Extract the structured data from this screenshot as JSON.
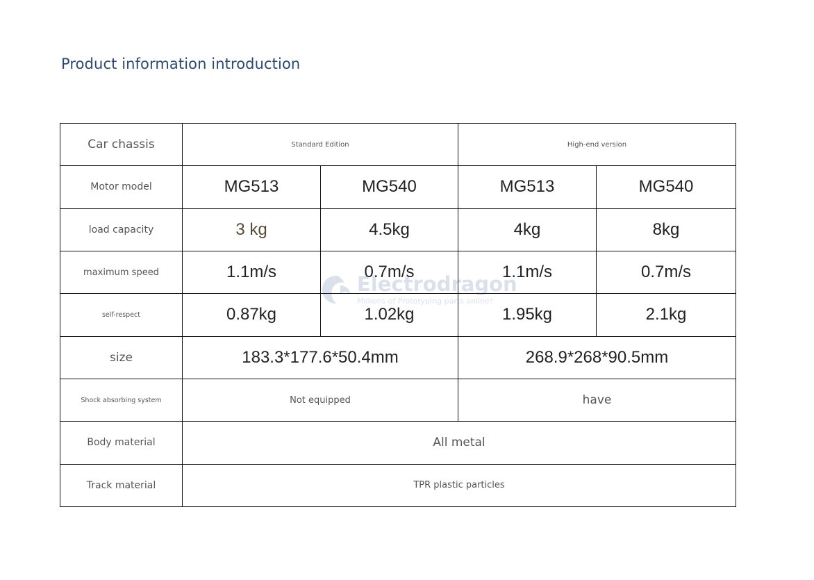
{
  "title": "Product information introduction",
  "watermark": {
    "name": "Electrodragon",
    "tagline": "Millions of Prototyping parts online!"
  },
  "table": {
    "car_chassis": {
      "label": "Car chassis",
      "standard": "Standard Edition",
      "high_end": "High-end version"
    },
    "motor_model": {
      "label": "Motor model",
      "values": [
        "MG513",
        "MG540",
        "MG513",
        "MG540"
      ]
    },
    "load_capacity": {
      "label": "load capacity",
      "values": [
        "3 kg",
        "4.5kg",
        "4kg",
        "8kg"
      ]
    },
    "maximum_speed": {
      "label": "maximum speed",
      "values": [
        "1.1m/s",
        "0.7m/s",
        "1.1m/s",
        "0.7m/s"
      ]
    },
    "self_respect": {
      "label": "self-respect",
      "values": [
        "0.87kg",
        "1.02kg",
        "1.95kg",
        "2.1kg"
      ]
    },
    "size": {
      "label": "size",
      "standard": "183.3*177.6*50.4mm",
      "high_end": "268.9*268*90.5mm"
    },
    "shock": {
      "label": "Shock absorbing system",
      "standard": "Not equipped",
      "high_end": "have"
    },
    "body_material": {
      "label": "Body material",
      "value": "All metal"
    },
    "track_material": {
      "label": "Track material",
      "value": "TPR plastic particles"
    }
  }
}
